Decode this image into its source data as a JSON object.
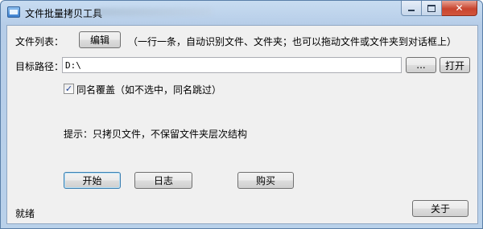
{
  "window": {
    "title": "文件批量拷贝工具",
    "close_glyph": "✕"
  },
  "file_list": {
    "label": "文件列表：",
    "edit_button": "编辑",
    "hint": "（一行一条，自动识别文件、文件夹；也可以拖动文件或文件夹到对话框上）"
  },
  "target": {
    "label": "目标路径：",
    "path_value": "D:\\",
    "browse_button": "...",
    "open_button": "打开"
  },
  "overwrite": {
    "checked": true,
    "check_glyph": "✓",
    "label": "同名覆盖（如不选中，同名跳过）"
  },
  "tip": "提示：只拷贝文件，不保留文件夹层次结构",
  "actions": {
    "start": "开始",
    "log": "日志",
    "buy": "购买",
    "about": "关于"
  },
  "status": "就绪"
}
